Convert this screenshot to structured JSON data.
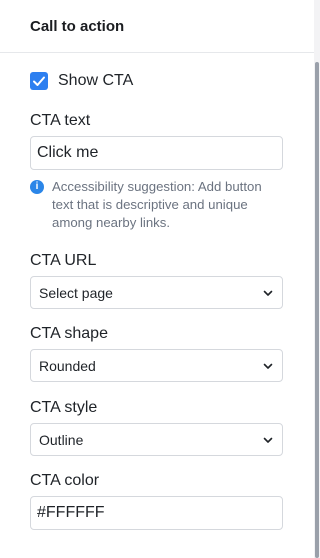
{
  "header": {
    "title": "Call to action"
  },
  "show_cta": {
    "label": "Show CTA",
    "checked": true
  },
  "cta_text": {
    "label": "CTA text",
    "value": "Click me"
  },
  "note": {
    "text": "Accessibility suggestion: Add button text that is descriptive and unique among nearby links."
  },
  "cta_url": {
    "label": "CTA URL",
    "value": "Select page"
  },
  "cta_shape": {
    "label": "CTA shape",
    "value": "Rounded"
  },
  "cta_style": {
    "label": "CTA style",
    "value": "Outline"
  },
  "cta_color": {
    "label": "CTA color",
    "value": "#FFFFFF"
  },
  "colors": {
    "accent": "#2d7ff0",
    "info": "#2b86e8"
  },
  "icons": {
    "checkbox": "checkmark-icon",
    "info": "info-icon",
    "chevron": "chevron-down-icon"
  }
}
